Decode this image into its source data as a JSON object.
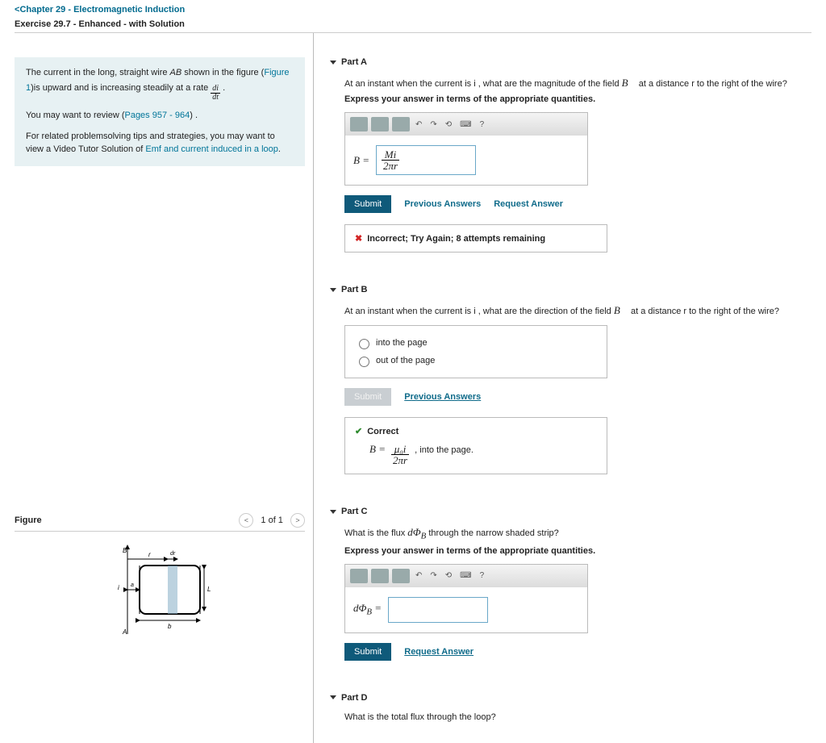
{
  "header": {
    "chapter_link": "Chapter 29 - Electromagnetic Induction",
    "exercise": "Exercise 29.7 - Enhanced - with Solution"
  },
  "context": {
    "line1_a": "The current in the long, straight wire ",
    "line1_ab": "AB",
    "line1_b": " shown in the figure (",
    "fig_link": "Figure 1",
    "line1_c": ")is upward and is increasing steadily at a rate ",
    "line1_rate": "di/dt",
    "line1_d": " .",
    "review_a": "You may want to review (",
    "review_link": "Pages 957 - 964",
    "review_b": ") .",
    "tips_a": "For related problemsolving tips and strategies, you may want to view a Video Tutor Solution of ",
    "tips_link": "Emf and current induced in a loop",
    "tips_b": "."
  },
  "partA": {
    "title": "Part A",
    "q1": "At an instant when the current is i , what are the magnitude of the field ",
    "bvec": "B⃗",
    "q2": " at a distance r to the right of the wire?",
    "instruct": "Express your answer in terms of the appropriate quantities.",
    "lhs": "B =",
    "ans_num": "Mi",
    "ans_den": "2πr",
    "submit": "Submit",
    "prev": "Previous Answers",
    "req": "Request Answer",
    "feedback": "Incorrect; Try Again; 8 attempts remaining"
  },
  "partB": {
    "title": "Part B",
    "q1": "At an instant when the current is i , what are the direction of the field ",
    "bvec": "B⃗",
    "q2": " at a distance r to the right of the wire?",
    "opt1": "into the page",
    "opt2": "out of the page",
    "submit": "Submit",
    "prev": "Previous Answers",
    "correct": "Correct",
    "soln_lhs": "B =",
    "soln_num": "μ₀i",
    "soln_den": "2πr",
    "soln_tail": ", into the page."
  },
  "partC": {
    "title": "Part C",
    "q": "What is the flux dΦ_B through the narrow shaded strip?",
    "instruct": "Express your answer in terms of the appropriate quantities.",
    "lhs": "dΦ_B =",
    "submit": "Submit",
    "req": "Request Answer"
  },
  "partD": {
    "title": "Part D",
    "q": "What is the total flux through the loop?"
  },
  "figure": {
    "label": "Figure",
    "pager": "1 of 1"
  }
}
